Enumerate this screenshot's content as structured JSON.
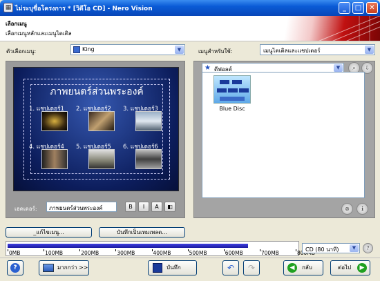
{
  "window": {
    "title": "ไม่ระบุชื่อโครงการ * [วิดีโอ CD] - Nero Vision",
    "minimize": "_",
    "maximize": "□",
    "close": "✕"
  },
  "header": {
    "title": "เลือกเมนู",
    "subtitle": "เลือกเมนูหลักและเมนูไตเติล"
  },
  "menu_settings": {
    "label": "ตัวเลือกเมนู:",
    "value": "King"
  },
  "menu_target": {
    "label": "เมนูสำหรับใช้:",
    "value": "เมนูไตเติลและแชปเตอร์"
  },
  "preview": {
    "menu_title": "ภาพยนตร์ส่วนพระองค์",
    "chapters": [
      {
        "label": "1. แชปเตอร์1"
      },
      {
        "label": "2. แชปเตอร์2"
      },
      {
        "label": "3. แชปเตอร์3"
      },
      {
        "label": "4. แชปเตอร์4"
      },
      {
        "label": "5. แชปเตอร์5"
      },
      {
        "label": "6. แชปเตอร์6"
      }
    ],
    "header_label": "เฮดเดอร์:",
    "header_value": "ภาพยนตร์ส่วนพระองค์"
  },
  "templates": {
    "category": "ดีฟอลต์",
    "items": [
      {
        "label": "Blue Disc"
      }
    ]
  },
  "buttons": {
    "edit_menu": "_แก้ไขเมนู...",
    "save_template": "บันทึกเป็นเทมเพลต...",
    "more": "มากกว่า >>",
    "save": "บันทึก",
    "back": "กลับ",
    "next": "ต่อไป"
  },
  "capacity": {
    "ticks": [
      "0MB",
      "100MB",
      "200MB",
      "300MB",
      "400MB",
      "500MB",
      "600MB",
      "700MB",
      "800MB"
    ],
    "disc_type": "CD (80 นาที)",
    "used_fraction": 0.835
  },
  "colors": {
    "titlebar": "#0a5bd6",
    "preview_bg": "#0c1d5c",
    "capacity_fill": "#1a1aa0"
  },
  "icons": {
    "help": "help-icon",
    "star": "star-icon"
  }
}
